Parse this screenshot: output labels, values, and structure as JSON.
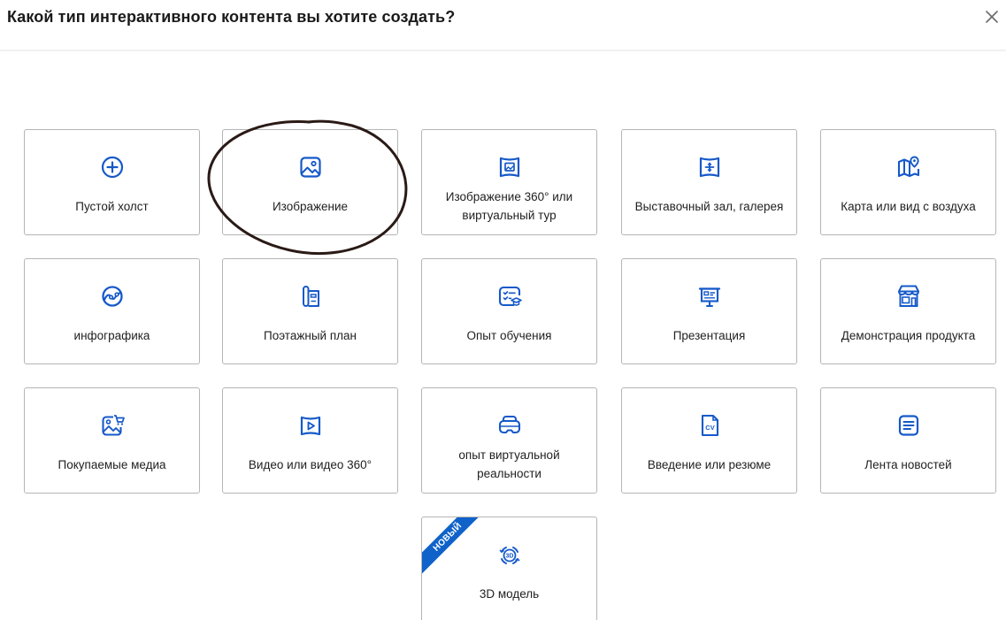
{
  "dialog": {
    "title": "Какой тип интерактивного контента вы хотите создать?",
    "close_label": "×"
  },
  "colors": {
    "icon_blue": "#1559c9",
    "badge_blue": "#0f62c9",
    "tile_border": "#b5b5b5",
    "annotation_ring": "#2a1a16"
  },
  "tiles": [
    {
      "label": "Пустой холст",
      "icon": "plus-circle-icon"
    },
    {
      "label": "Изображение",
      "icon": "image-icon"
    },
    {
      "label": "Изображение 360° или виртуальный тур",
      "icon": "panorama-icon"
    },
    {
      "label": "Выставочный зал, галерея",
      "icon": "gallery-icon"
    },
    {
      "label": "Карта или вид с воздуха",
      "icon": "map-pin-icon"
    },
    {
      "label": "инфографика",
      "icon": "infographic-icon"
    },
    {
      "label": "Поэтажный план",
      "icon": "floor-plan-icon"
    },
    {
      "label": "Опыт обучения",
      "icon": "learning-icon"
    },
    {
      "label": "Презентация",
      "icon": "presentation-icon"
    },
    {
      "label": "Демонстрация продукта",
      "icon": "storefront-icon"
    },
    {
      "label": "Покупаемые медиа",
      "icon": "shoppable-image-icon"
    },
    {
      "label": "Видео или видео 360°",
      "icon": "video-360-icon"
    },
    {
      "label": "опыт виртуальной реальности",
      "icon": "vr-headset-icon"
    },
    {
      "label": "Введение или резюме",
      "icon": "cv-document-icon"
    },
    {
      "label": "Лента новостей",
      "icon": "news-feed-icon"
    },
    {
      "label": "3D модель",
      "icon": "3d-model-icon",
      "badge": "НОВЫЙ"
    }
  ]
}
